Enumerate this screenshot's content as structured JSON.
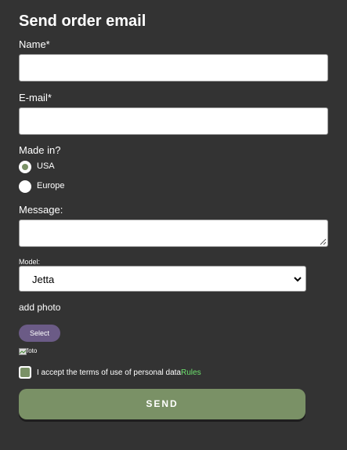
{
  "form": {
    "title": "Send order email",
    "name_label": "Name*",
    "name_value": "",
    "email_label": "E-mail*",
    "email_value": "",
    "made_in_label": "Made in?",
    "made_in_options": [
      {
        "label": "USA",
        "selected": true
      },
      {
        "label": "Europe",
        "selected": false
      }
    ],
    "message_label": "Message:",
    "message_value": "",
    "model_label": "Model:",
    "model_value": "Jetta",
    "add_photo_label": "add photo",
    "select_button_label": "Select",
    "photo_alt_text": "foto",
    "terms_checked": true,
    "terms_text": "I accept the terms of use of personal data",
    "terms_link": "Rules",
    "send_button_label": "SEND"
  },
  "colors": {
    "background": "#333333",
    "accent_green": "#7a9166",
    "select_button": "#6b5b86",
    "rules_link": "#6ee46e"
  },
  "icons": [
    "chevron-down-icon",
    "broken-image-icon",
    "resize-grip-icon"
  ]
}
